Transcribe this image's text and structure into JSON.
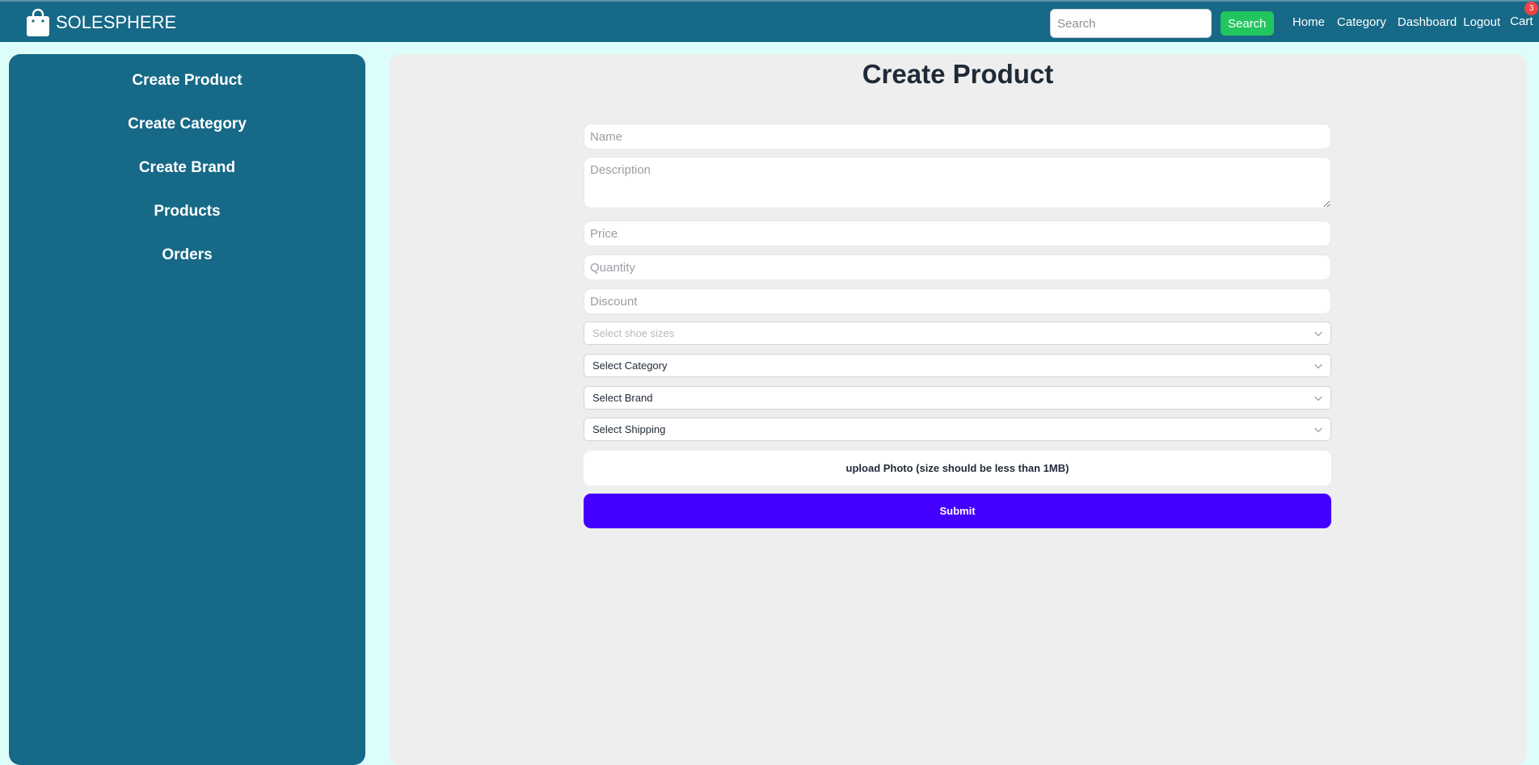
{
  "navbar": {
    "brand": "SOLESPHERE",
    "brand_icon": "shopping-bag-icon",
    "search_placeholder": "Search",
    "search_value": "",
    "search_button": "Search",
    "links": {
      "home": "Home",
      "category": "Category",
      "dashboard": "Dashboard",
      "logout": "Logout",
      "cart": "Cart"
    },
    "cart_count": "3"
  },
  "sidebar": {
    "items": [
      {
        "label": "Create Product"
      },
      {
        "label": "Create Category"
      },
      {
        "label": "Create Brand"
      },
      {
        "label": "Products"
      },
      {
        "label": "Orders"
      }
    ]
  },
  "main": {
    "title": "Create Product",
    "fields": {
      "name": {
        "placeholder": "Name",
        "value": ""
      },
      "description": {
        "placeholder": "Description",
        "value": ""
      },
      "price": {
        "placeholder": "Price",
        "value": ""
      },
      "quantity": {
        "placeholder": "Quantity",
        "value": ""
      },
      "discount": {
        "placeholder": "Discount",
        "value": ""
      }
    },
    "selects": {
      "sizes": "Select shoe sizes",
      "category": "Select Category",
      "brand": "Select Brand",
      "shipping": "Select Shipping"
    },
    "upload_label": "upload Photo (size should be less than 1MB)",
    "submit_label": "Submit"
  },
  "colors": {
    "navbar_bg": "#166987",
    "page_bg": "#dcfdf9",
    "panel_bg": "#eeeeee",
    "search_button": "#22c55e",
    "submit_button": "#4400ff",
    "badge": "#ef4444"
  }
}
